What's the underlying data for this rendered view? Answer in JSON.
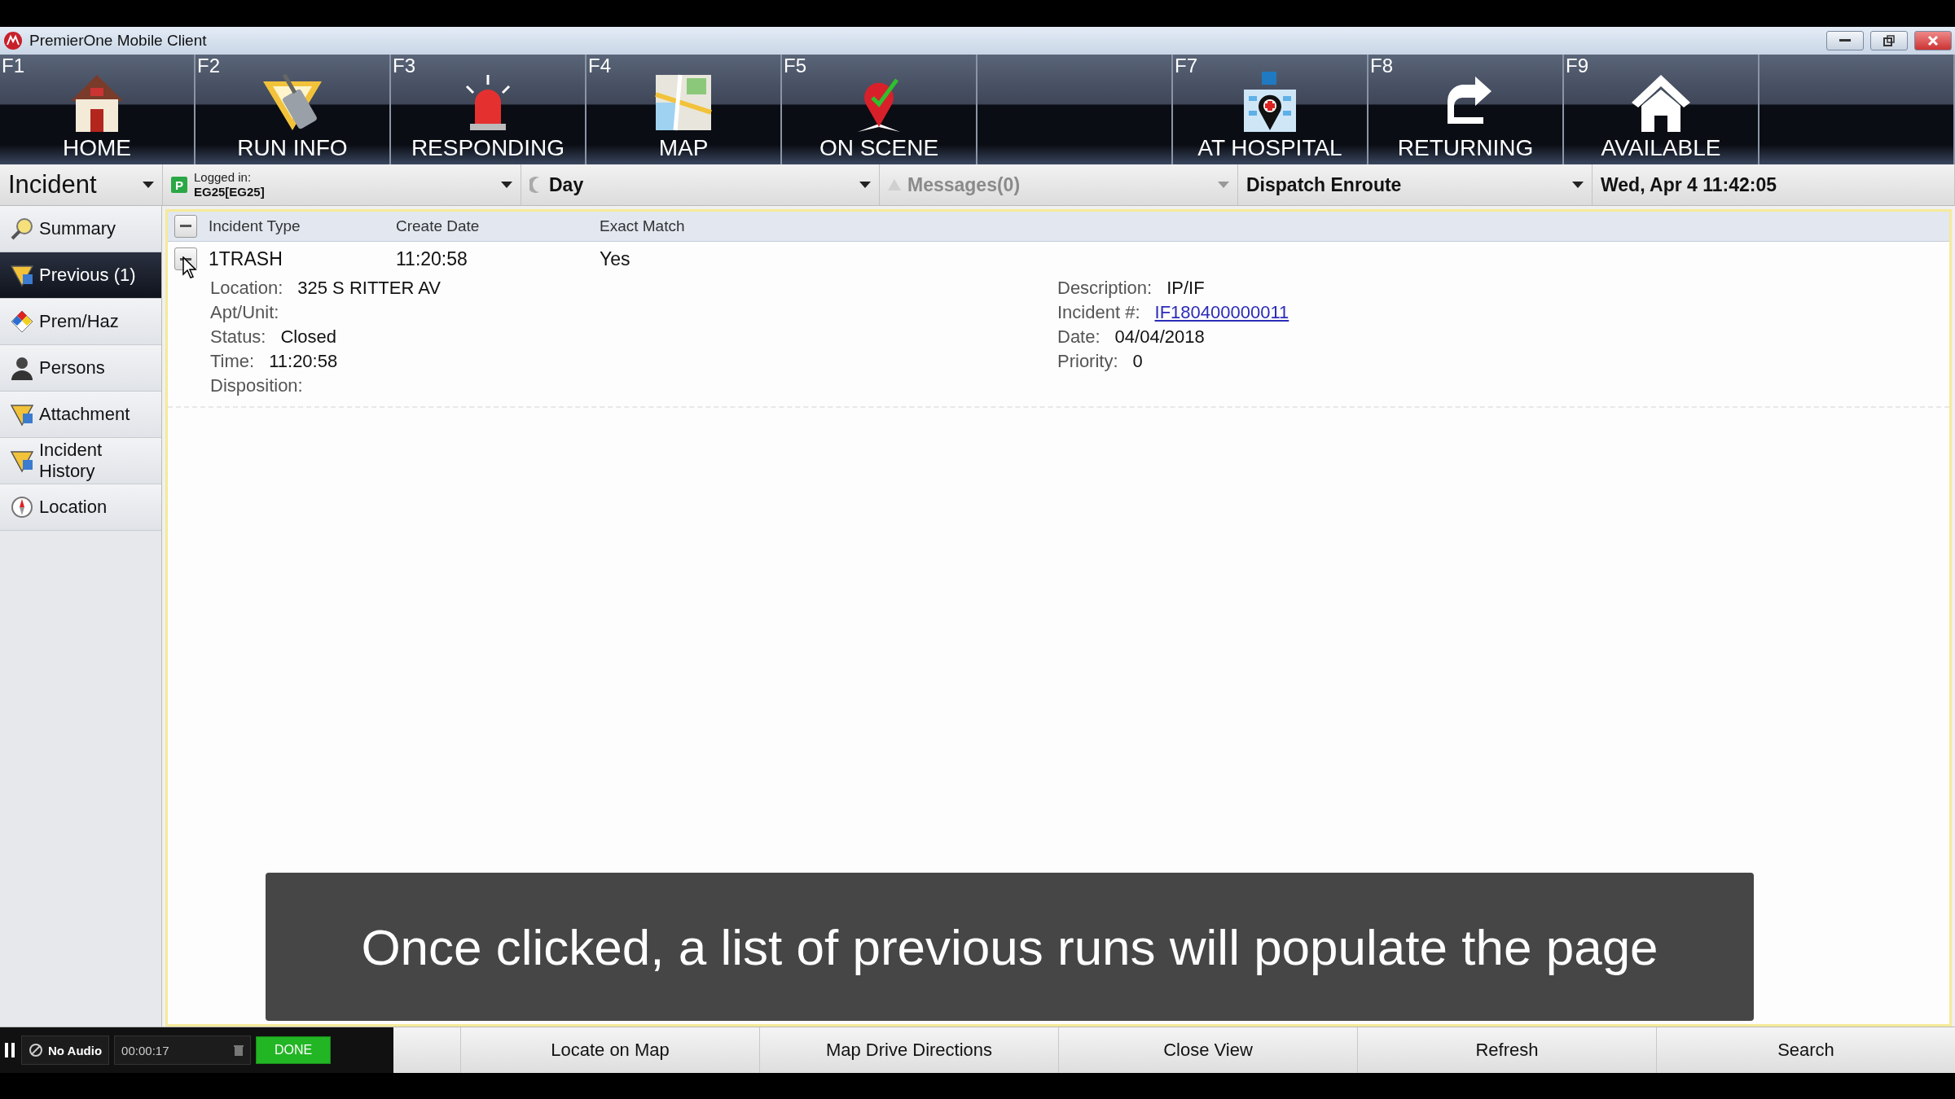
{
  "window": {
    "title": "PremierOne Mobile Client"
  },
  "toolbar": [
    {
      "kind": "button",
      "key": "F1",
      "label": "HOME"
    },
    {
      "kind": "button",
      "key": "F2",
      "label": "RUN INFO"
    },
    {
      "kind": "button",
      "key": "F3",
      "label": "RESPONDING"
    },
    {
      "kind": "button",
      "key": "F4",
      "label": "MAP"
    },
    {
      "kind": "button",
      "key": "F5",
      "label": "ON SCENE"
    },
    {
      "kind": "empty"
    },
    {
      "kind": "button",
      "key": "F7",
      "label": "AT HOSPITAL"
    },
    {
      "kind": "button",
      "key": "F8",
      "label": "RETURNING"
    },
    {
      "kind": "button",
      "key": "F9",
      "label": "AVAILABLE"
    },
    {
      "kind": "empty"
    }
  ],
  "status_bar": {
    "mode": "Incident",
    "badge": "P",
    "logged_in_label": "Logged in:",
    "logged_in_value": "EG25[EG25]",
    "shift": "Day",
    "messages": "Messages(0)",
    "dispatch_status": "Dispatch Enroute",
    "datetime": "Wed, Apr 4 11:42:05"
  },
  "sidebar": {
    "items": [
      {
        "label": "Summary",
        "selected": false
      },
      {
        "label": "Previous (1)",
        "selected": true
      },
      {
        "label": "Prem/Haz",
        "selected": false
      },
      {
        "label": "Persons",
        "selected": false
      },
      {
        "label": "Attachment",
        "selected": false
      },
      {
        "label": "Incident History",
        "selected": false
      },
      {
        "label": "Location",
        "selected": false
      }
    ]
  },
  "table": {
    "columns": [
      "Incident Type",
      "Create Date",
      "Exact Match"
    ],
    "rows": [
      {
        "expanded": true,
        "cells": [
          "1TRASH",
          "11:20:58",
          "Yes"
        ],
        "details_left": [
          {
            "label": "Location:",
            "value": "325 S RITTER AV"
          },
          {
            "label": "Apt/Unit:"
          },
          {
            "label": "Status:",
            "value": "Closed"
          },
          {
            "label": "Time:",
            "value": "11:20:58"
          },
          {
            "label": "Disposition:"
          }
        ],
        "details_right": [
          {
            "label": "Description:",
            "value": "IP/IF"
          },
          {
            "label": "Incident #:",
            "value": "IF180400000011",
            "kind": "link"
          },
          {
            "label": "Date:",
            "value": "04/04/2018"
          },
          {
            "label": "Priority:",
            "value": "0"
          }
        ]
      }
    ]
  },
  "caption": "Once clicked, a list of previous runs will populate the page",
  "player": {
    "audio": "No Audio",
    "time": "00:00:17",
    "done": "DONE"
  },
  "actions": [
    "Locate on Map",
    "Map Drive Directions",
    "Close View",
    "Refresh",
    "Search"
  ]
}
